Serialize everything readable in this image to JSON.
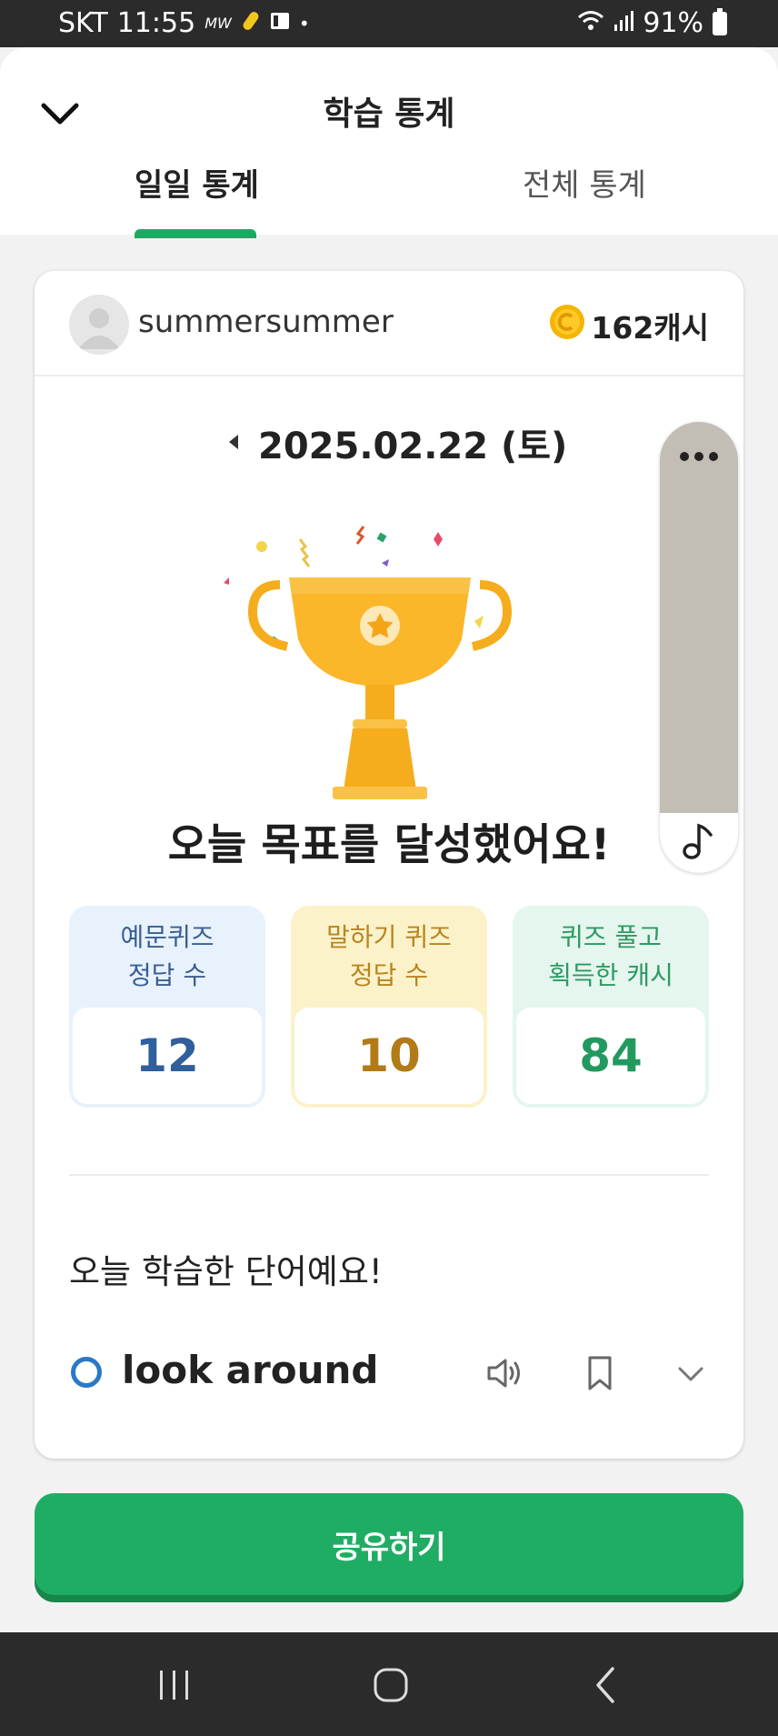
{
  "status_bar": {
    "carrier": "SKT",
    "time": "11:55",
    "notif_text": "MW",
    "battery": "91%"
  },
  "header": {
    "title": "학습 통계",
    "tabs": [
      {
        "label": "일일 통계",
        "selected": true
      },
      {
        "label": "전체 통계",
        "selected": false
      }
    ],
    "accent_color": "#1fa863"
  },
  "profile": {
    "username": "summersummer",
    "cash": "162캐시"
  },
  "date": "2025.02.22 (토)",
  "achievement": "오늘 목표를 달성했어요!",
  "stats": [
    {
      "line1": "예문퀴즈",
      "line2": "정답 수",
      "value": "12"
    },
    {
      "line1": "말하기 퀴즈",
      "line2": "정답 수",
      "value": "10"
    },
    {
      "line1": "퀴즈 풀고",
      "line2": "획득한 캐시",
      "value": "84"
    }
  ],
  "learned": {
    "title": "오늘 학습한 단어예요!",
    "words": [
      {
        "text": "look around"
      }
    ]
  },
  "share_label": "공유하기",
  "icons": [
    "chevron-down-icon",
    "coin-icon",
    "trophy-icon",
    "speaker-icon",
    "bookmark-icon",
    "more-dots-icon",
    "music-note-icon"
  ]
}
